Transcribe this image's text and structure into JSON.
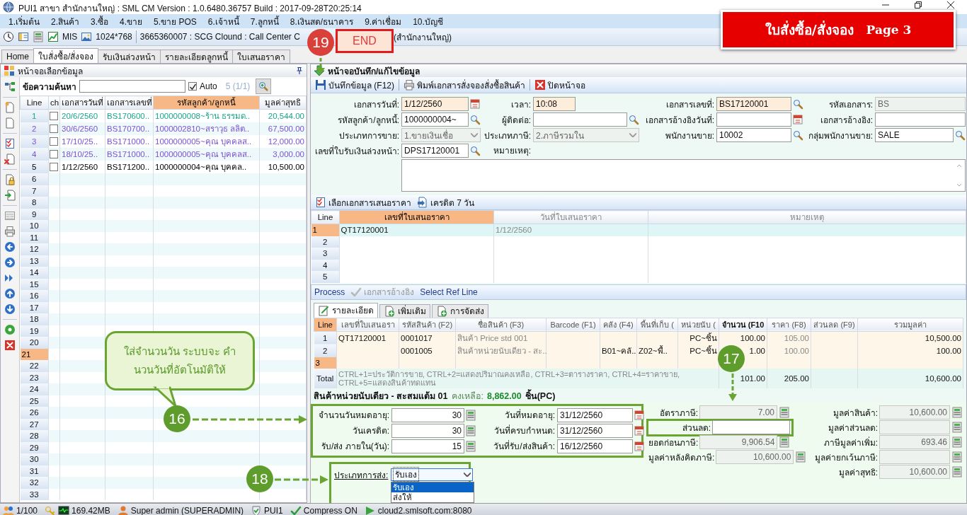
{
  "window": {
    "title": "PUI1 สาขา สำนักงานใหญ่ : SML CM Version : 1.0.6480.36757  Build : 2017-09-28T20:25:14"
  },
  "menu": [
    "1.เริ่มต้น",
    "2.สินค้า",
    "3.ซื้อ",
    "4.ขาย",
    "5.ขาย POS",
    "6.เจ้าหนี้",
    "7.ลูกหนี้",
    "8.เงินสด/ธนาคาร",
    "9.ค่าเชื่อม",
    "10.บัญชี"
  ],
  "toolbar": {
    "mis": "MIS",
    "resolution": "1024*768",
    "connection": "3665360007 : SCG Clound : Call Center C",
    "branch": "(สำนักงานใหญ่)"
  },
  "tabs": [
    {
      "label": "Home",
      "selected": false
    },
    {
      "label": "ใบสั่งซื้อ/สั่งจอง",
      "selected": true
    },
    {
      "label": "รับเงินล่วงหน้า",
      "selected": false
    },
    {
      "label": "รายละเอียดลูกหนี้",
      "selected": false
    },
    {
      "label": "ใบเสนอราคา",
      "selected": false
    }
  ],
  "left_panel": {
    "title": "หน้าจอเลือกข้อมูล",
    "search_label": "ข้อความค้นหา",
    "auto": {
      "label": "Auto",
      "checked": true
    },
    "count": "5 (1/1)",
    "columns": [
      {
        "label": "Line",
        "sorted": false
      },
      {
        "label": "ch",
        "sorted": false
      },
      {
        "label": "เอกสารวันที่",
        "sorted": false
      },
      {
        "label": "เอกสารเลขที่",
        "sorted": false
      },
      {
        "label": "รหัสลูกค้า/ลูกหนี้",
        "sorted": true
      },
      {
        "label": "มูลค่าสุทธิ",
        "sorted": false
      }
    ],
    "rows": [
      {
        "line": "1",
        "checked": false,
        "date": "20/6/2560",
        "doc": "BS170600..",
        "customer": "1000000008~ร้าน ธรรมด..",
        "amount": "20,544.00",
        "color": "#1aa58a",
        "selected": false
      },
      {
        "line": "2",
        "checked": false,
        "date": "30/6/2560",
        "doc": "BS170700..",
        "customer": "1000002810~สราวุธ ลลิต..",
        "amount": "67,500.00",
        "color": "#7b52d3",
        "selected": false
      },
      {
        "line": "3",
        "checked": false,
        "date": "17/10/25..",
        "doc": "BS171000..",
        "customer": "1000000005~คุณ บุคคลส..",
        "amount": "12,000.00",
        "color": "#7b52d3",
        "selected": false
      },
      {
        "line": "4",
        "checked": false,
        "date": "18/10/25..",
        "doc": "BS171000..",
        "customer": "1000000005~คุณ บุคคลส..",
        "amount": "3,000.00",
        "color": "#7b52d3",
        "selected": false
      },
      {
        "line": "5",
        "checked": false,
        "date": "1/12/2560",
        "doc": "BS171200..",
        "customer": "1000000004~คุณ บุคคล..",
        "amount": "10,500.00",
        "color": "#000000",
        "selected": false
      },
      {
        "line": "6",
        "selected": false
      },
      {
        "line": "7",
        "selected": false
      },
      {
        "line": "8",
        "selected": false
      },
      {
        "line": "9",
        "selected": false
      },
      {
        "line": "10",
        "selected": false
      },
      {
        "line": "11",
        "selected": false
      },
      {
        "line": "12",
        "selected": false
      },
      {
        "line": "13",
        "selected": false
      },
      {
        "line": "14",
        "selected": false
      },
      {
        "line": "15",
        "selected": false
      },
      {
        "line": "16",
        "selected": false
      },
      {
        "line": "17",
        "selected": false
      },
      {
        "line": "18",
        "selected": false
      },
      {
        "line": "19",
        "selected": false
      },
      {
        "line": "20",
        "selected": false
      },
      {
        "line": "21",
        "selected": true
      },
      {
        "line": "22",
        "selected": false
      },
      {
        "line": "23",
        "selected": false
      },
      {
        "line": "24",
        "selected": false
      },
      {
        "line": "25",
        "selected": false
      },
      {
        "line": "26",
        "selected": false
      },
      {
        "line": "27",
        "selected": false
      },
      {
        "line": "28",
        "selected": false
      },
      {
        "line": "29",
        "selected": false
      },
      {
        "line": "30",
        "selected": false
      },
      {
        "line": "31",
        "selected": false
      },
      {
        "line": "32",
        "selected": false
      },
      {
        "line": "33",
        "selected": false
      }
    ]
  },
  "entry_header": "หน้าจอบันทึก/แก้ไขข้อมูล",
  "entry_actions": [
    {
      "label": "บันทึกข้อมูล (F12)",
      "kind": "save"
    },
    {
      "label": "พิมพ์เอกสารสั่งจองสั่งซื้อสินค้า",
      "kind": "print"
    },
    {
      "label": "ปิดหน้าจอ",
      "kind": "close"
    }
  ],
  "entry_form": [
    [
      {
        "label": "เอกสารวันที่:",
        "value": "1/12/2560",
        "kind": "date",
        "required": true,
        "disabled": false
      },
      {
        "label": "เวลา:",
        "value": "10:08",
        "kind": "short",
        "required": true,
        "disabled": false
      },
      {
        "label": "เอกสารเลขที่:",
        "value": "BS17120001",
        "kind": "search",
        "required": true,
        "disabled": false
      },
      {
        "label": "รหัสเอกสาร:",
        "value": "BS",
        "kind": "text",
        "required": false,
        "disabled": true
      }
    ],
    [
      {
        "label": "รหัสลูกค้า/ลูกหนี้:",
        "value": "1000000004~",
        "kind": "search",
        "required": false,
        "disabled": false
      },
      {
        "label": "ผู้ติดต่อ:",
        "kind": "search",
        "required": false,
        "disabled": false
      },
      {
        "label": "เอกสารอ้างอิงวันที่:",
        "kind": "date",
        "required": false,
        "disabled": false
      },
      {
        "label": "เอกสารอ้างอิง:",
        "kind": "text",
        "required": false,
        "disabled": false
      }
    ],
    [
      {
        "label": "ประเภทการขาย:",
        "value": "1.ขายเงินเชื่อ",
        "kind": "select",
        "required": false,
        "disabled": true
      },
      {
        "label": "ประเภทภาษี:",
        "value": "2.ภาษีรวมใน",
        "kind": "select",
        "required": false,
        "disabled": true
      },
      {
        "label": "พนักงานขาย:",
        "value": "10002",
        "kind": "search",
        "required": false,
        "disabled": false
      },
      {
        "label": "กลุ่มพนักงานขาย:",
        "value": "SALE",
        "kind": "search",
        "required": false,
        "disabled": false
      }
    ],
    [
      {
        "label": "เลขที่ใบรับเงินล่วงหน้า:",
        "value": "DPS17120001",
        "kind": "search",
        "required": false,
        "disabled": false
      }
    ]
  ],
  "remark": {
    "label": "หมายเหตุ:"
  },
  "quote_actions": [
    {
      "label": "เลือกเอกสารเสนอราคา",
      "kind": "checklist"
    },
    {
      "label": "เครดิต 7 วัน",
      "kind": "credit"
    }
  ],
  "quote_grid": {
    "columns": [
      {
        "label": "Line",
        "sorted": false
      },
      {
        "label": "เลขที่ใบเสนอราคา",
        "sorted": true
      },
      {
        "label": "วันที่ใบเสนอราคา",
        "sorted": false
      },
      {
        "label": "หมายเหตุ",
        "sorted": false
      }
    ],
    "rows": [
      {
        "line": "1",
        "quote_no": "QT17120001",
        "quote_date": "1/12/2560",
        "selected": true
      },
      {
        "line": "2",
        "selected": false
      },
      {
        "line": "3",
        "selected": false
      },
      {
        "line": "4",
        "selected": false
      },
      {
        "line": "5",
        "selected": false
      }
    ]
  },
  "process_bar": [
    {
      "label": "Process",
      "disabled": false,
      "kind": "text"
    },
    {
      "label": "เอกสารอ้างอิง",
      "disabled": true,
      "kind": "check"
    },
    {
      "label": "Select Ref Line",
      "disabled": false,
      "kind": "text"
    }
  ],
  "detail_tabs": [
    {
      "label": "รายละเอียด",
      "selected": true,
      "kind": "edit"
    },
    {
      "label": "เพิ่มเติม",
      "selected": false,
      "kind": "add"
    },
    {
      "label": "การจัดส่ง",
      "selected": false,
      "kind": "add"
    }
  ],
  "items_grid": {
    "columns": [
      {
        "label": "Line",
        "sorted": true
      },
      {
        "label": "เลขที่ใบเสนอรา",
        "sorted": false
      },
      {
        "label": "รหัสสินค้า (F2)",
        "sorted": false
      },
      {
        "label": "ชื่อสินค้า (F3)",
        "sorted": false
      },
      {
        "label": "Barcode (F1)",
        "sorted": false
      },
      {
        "label": "คลัง (F4)",
        "sorted": false
      },
      {
        "label": "พื้นที่เก็บ (",
        "sorted": false
      },
      {
        "label": "หน่วยนับ (",
        "sorted": false
      },
      {
        "label": "จำนวน (F10",
        "sorted": false
      },
      {
        "label": "ราคา (F8)",
        "sorted": false
      },
      {
        "label": "ส่วนลด (F9)",
        "sorted": false
      },
      {
        "label": "รวมมูลค่า",
        "sorted": false
      }
    ],
    "rows": [
      {
        "selected": false,
        "cells": [
          "1",
          "QT17120001",
          "0001017",
          "สินค้า Price std 001",
          null,
          null,
          null,
          "PC~ชิ้น",
          "100.00",
          "105.00",
          null,
          "10,500.00"
        ]
      },
      {
        "selected": false,
        "cells": [
          "2",
          null,
          "0001005",
          "สินค้าหน่วยนับเดียว - สะ..",
          null,
          "B01~คลั..",
          "Z02~พื้..",
          "PC~ชิ้น",
          "1.00",
          "100.00",
          null,
          "100.00"
        ]
      },
      {
        "selected": true,
        "cells": [
          "3",
          null,
          null,
          null,
          null,
          null,
          null,
          null,
          null,
          null,
          null,
          null
        ]
      }
    ],
    "total": {
      "label": "Total",
      "hint": "CTRL+1=ประวัติการขาย, CTRL+2=แสดงปริมาณคงเหลือ, CTRL+3=ตารางราคา, CTRL+4=ราคาขาย, CTRL+5=แสดงสินค้าทดแทน",
      "quantity": "101.00",
      "price": "205.00",
      "amount": "10,600.00"
    }
  },
  "stock_info": {
    "product": "สินค้าหน่วยนับเดียว - สะสมแต้ม 01",
    "label": "คงเหลือ:",
    "quantity": "8,862.00",
    "unit": "ชิ้น(PC)"
  },
  "terms": {
    "highlighted": true,
    "rows": [
      {
        "label": "จำนวนวันหมดอายุ:",
        "value": "30",
        "date_label": "วันที่หมดอายุ:",
        "date": "31/12/2560"
      },
      {
        "label": "วันเครดิต:",
        "value": "30",
        "date_label": "วันที่ครบกำหนด:",
        "date": "31/12/2560"
      },
      {
        "label": "รับ/ส่ง ภายใน(วัน):",
        "value": "15",
        "date_label": "วันที่รับ/ส่งสินค้า:",
        "date": "16/12/2560"
      }
    ]
  },
  "tax_summary": [
    {
      "label": "อัตราภาษี:",
      "value": "7.00",
      "editable": false,
      "highlighted": false
    },
    {
      "label": "ส่วนลด:",
      "editable": true,
      "highlighted": true
    },
    {
      "label": "ยอดก่อนภาษี:",
      "value": "9,906.54",
      "editable": false,
      "highlighted": false
    },
    {
      "label": "มูลค่าหลังคิดภาษี:",
      "value": "10,600.00",
      "editable": false,
      "highlighted": false
    }
  ],
  "value_summary": [
    {
      "label": "มูลค่าสินค้า:",
      "value": "10,600.00"
    },
    {
      "label": "มูลค่าส่วนลด:"
    },
    {
      "label": "ภาษีมูลค่าเพิ่ม:",
      "value": "693.46"
    },
    {
      "label": "มูลค่ายกเว้นภาษี:"
    },
    {
      "label": "มูลค่าสุทธิ:",
      "value": "10,600.00"
    }
  ],
  "delivery": {
    "label": "ประเภทการส่ง:",
    "value": "รับเอง",
    "expanded": true,
    "highlighted": true,
    "options": [
      {
        "label": "รับเอง",
        "selected": true
      },
      {
        "label": "ส่งให้",
        "selected": false
      }
    ]
  },
  "status_bar": [
    {
      "kind": "users",
      "text": "1/100"
    },
    {
      "kind": "memory",
      "text": "169.42MB"
    },
    {
      "kind": "user",
      "text": "Super admin (SUPERADMIN)"
    },
    {
      "kind": "database",
      "text": "PUI1"
    },
    {
      "kind": "compress",
      "text": "Compress ON"
    },
    {
      "kind": "server",
      "text": "cloud2.smlsoft.com:8080"
    }
  ],
  "annotations": {
    "banner": {
      "title": "ใบสั่งซื้อ/สั่งจอง",
      "page": "Page 3"
    },
    "end_label": "END",
    "bubble": "ใส่จำนวนวัน ระบบจะ คำนวนวันที่อัตโนมัติให้",
    "markers": [
      "19",
      "17",
      "16",
      "18"
    ]
  }
}
